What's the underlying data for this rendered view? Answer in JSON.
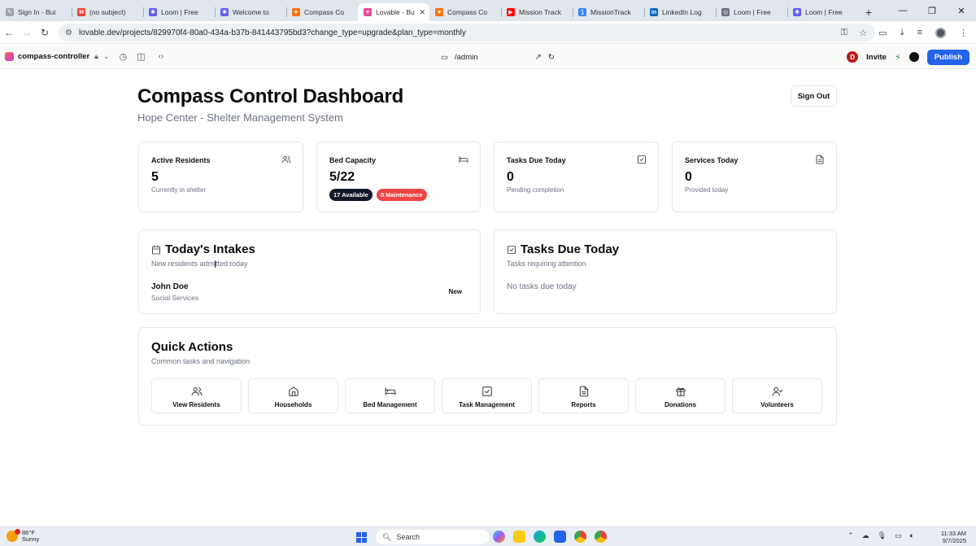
{
  "browser": {
    "tabs": [
      {
        "title": "Sign In - Bui",
        "color": "#9ca3af",
        "glyph": "✎"
      },
      {
        "title": "(no subject)",
        "color": "#ea4335",
        "glyph": "M"
      },
      {
        "title": "Loom | Free",
        "color": "#625df5",
        "glyph": "✺"
      },
      {
        "title": "Welcome to",
        "color": "#625df5",
        "glyph": "✺"
      },
      {
        "title": "Compass Co",
        "color": "#f97316",
        "glyph": "♥"
      },
      {
        "title": "Lovable - Bu",
        "color": "#ec4899",
        "glyph": "♥",
        "active": true
      },
      {
        "title": "Compass Co",
        "color": "#f97316",
        "glyph": "♥"
      },
      {
        "title": "Mission Track",
        "color": "#ff0000",
        "glyph": "▶"
      },
      {
        "title": "MissionTrack",
        "color": "#3b82f6",
        "glyph": "⟆"
      },
      {
        "title": "LinkedIn Log",
        "color": "#0a66c2",
        "glyph": "in"
      },
      {
        "title": "Loom | Free",
        "color": "#6b7280",
        "glyph": "◎"
      },
      {
        "title": "Loom | Free",
        "color": "#625df5",
        "glyph": "✺"
      }
    ],
    "url": "lovable.dev/projects/829970f4-80a0-434a-b37b-841443795bd3?change_type=upgrade&plan_type=monthly"
  },
  "lovable": {
    "project_name": "compass-controller",
    "path": "/admin",
    "invite_label": "Invite",
    "avatar_initial": "D",
    "publish_label": "Publish"
  },
  "dashboard": {
    "title": "Compass Control Dashboard",
    "subtitle": "Hope Center - Shelter Management System",
    "sign_out_label": "Sign Out",
    "stats": {
      "residents": {
        "title": "Active Residents",
        "value": "5",
        "sub": "Currently in shelter"
      },
      "beds": {
        "title": "Bed Capacity",
        "value": "5/22",
        "available": "17 Available",
        "maintenance": "0 Maintenance"
      },
      "tasks": {
        "title": "Tasks Due Today",
        "value": "0",
        "sub": "Pending completion"
      },
      "services": {
        "title": "Services Today",
        "value": "0",
        "sub": "Provided today"
      }
    },
    "intakes": {
      "title": "Today's Intakes",
      "subtitle": "New residents admitted today",
      "items": [
        {
          "name": "John Doe",
          "department": "Social Services",
          "status": "New"
        }
      ]
    },
    "tasks_due": {
      "title": "Tasks Due Today",
      "subtitle": "Tasks requiring attention",
      "empty": "No tasks due today"
    },
    "quick_actions": {
      "title": "Quick Actions",
      "subtitle": "Common tasks and navigation",
      "items": [
        {
          "label": "View Residents",
          "icon": "users-icon"
        },
        {
          "label": "Households",
          "icon": "home-icon"
        },
        {
          "label": "Bed Management",
          "icon": "bed-icon"
        },
        {
          "label": "Task Management",
          "icon": "check-square-icon"
        },
        {
          "label": "Reports",
          "icon": "file-text-icon"
        },
        {
          "label": "Donations",
          "icon": "gift-icon"
        },
        {
          "label": "Volunteers",
          "icon": "user-check-icon"
        }
      ]
    },
    "colors": {
      "badge_available": "#111827",
      "badge_maintenance": "#ef4444",
      "publish": "#2563eb"
    }
  },
  "taskbar": {
    "temperature": "86°F",
    "condition": "Sunny",
    "search_label": "Search",
    "time": "11:33 AM",
    "date": "9/7/2025"
  }
}
